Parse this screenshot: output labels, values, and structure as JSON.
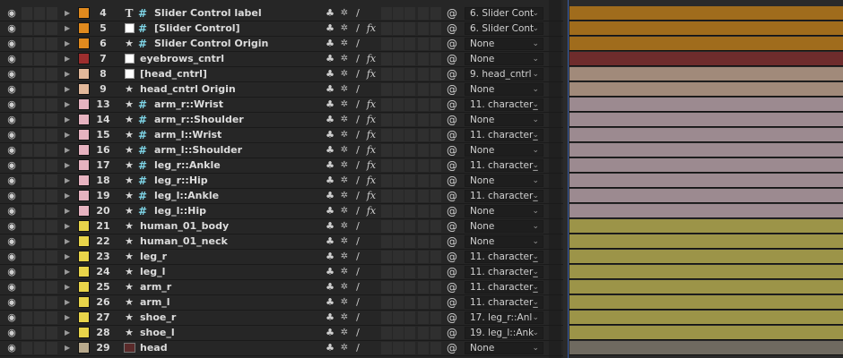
{
  "layers": [
    {
      "num": "4",
      "type": "text",
      "hash": true,
      "name": "Slider Control label",
      "label_color": "#e08a1e",
      "parent": "6. Slider Cont",
      "fx": false,
      "bar_color": "#a06c1c"
    },
    {
      "num": "5",
      "type": "solid",
      "hash": true,
      "name": "[Slider Control]",
      "label_color": "#e08a1e",
      "parent": "6. Slider Cont",
      "fx": true,
      "bar_color": "#a06c1c"
    },
    {
      "num": "6",
      "type": "star",
      "hash": true,
      "name": "Slider Control Origin",
      "label_color": "#e08a1e",
      "parent": "None",
      "fx": false,
      "bar_color": "#a06c1c"
    },
    {
      "num": "7",
      "type": "solid",
      "hash": false,
      "name": "eyebrows_cntrl",
      "label_color": "#9c2e2e",
      "parent": "None",
      "fx": true,
      "bar_color": "#6e2c2c"
    },
    {
      "num": "8",
      "type": "solid",
      "hash": false,
      "name": "[head_cntrl]",
      "label_color": "#e2b89a",
      "parent": "9. head_cntrl",
      "fx": true,
      "bar_color": "#a18a7a"
    },
    {
      "num": "9",
      "type": "star",
      "hash": false,
      "name": "head_cntrl Origin",
      "label_color": "#e2b89a",
      "parent": "None",
      "fx": false,
      "bar_color": "#a18a7a"
    },
    {
      "num": "13",
      "type": "star",
      "hash": true,
      "name": "arm_r::Wrist",
      "label_color": "#e6b3c0",
      "parent": "11. character_",
      "fx": true,
      "bar_color": "#9c8a90"
    },
    {
      "num": "14",
      "type": "star",
      "hash": true,
      "name": "arm_r::Shoulder",
      "label_color": "#e6b3c0",
      "parent": "None",
      "fx": true,
      "bar_color": "#9c8a90"
    },
    {
      "num": "15",
      "type": "star",
      "hash": true,
      "name": "arm_l::Wrist",
      "label_color": "#e6b3c0",
      "parent": "11. character_",
      "fx": true,
      "bar_color": "#9c8a90"
    },
    {
      "num": "16",
      "type": "star",
      "hash": true,
      "name": "arm_l::Shoulder",
      "label_color": "#e6b3c0",
      "parent": "None",
      "fx": true,
      "bar_color": "#9c8a90"
    },
    {
      "num": "17",
      "type": "star",
      "hash": true,
      "name": "leg_r::Ankle",
      "label_color": "#e6b3c0",
      "parent": "11. character_",
      "fx": true,
      "bar_color": "#9c8a90"
    },
    {
      "num": "18",
      "type": "star",
      "hash": true,
      "name": "leg_r::Hip",
      "label_color": "#e6b3c0",
      "parent": "None",
      "fx": true,
      "bar_color": "#9c8a90"
    },
    {
      "num": "19",
      "type": "star",
      "hash": true,
      "name": "leg_l::Ankle",
      "label_color": "#e6b3c0",
      "parent": "11. character_",
      "fx": true,
      "bar_color": "#9c8a90"
    },
    {
      "num": "20",
      "type": "star",
      "hash": true,
      "name": "leg_l::Hip",
      "label_color": "#e6b3c0",
      "parent": "None",
      "fx": true,
      "bar_color": "#9c8a90"
    },
    {
      "num": "21",
      "type": "star",
      "hash": false,
      "name": "human_01_body",
      "label_color": "#e8d44a",
      "parent": "None",
      "fx": false,
      "bar_color": "#9c9448"
    },
    {
      "num": "22",
      "type": "star",
      "hash": false,
      "name": "human_01_neck",
      "label_color": "#e8d44a",
      "parent": "None",
      "fx": false,
      "bar_color": "#9c9448"
    },
    {
      "num": "23",
      "type": "star",
      "hash": false,
      "name": "leg_r",
      "label_color": "#e8d44a",
      "parent": "11. character_",
      "fx": false,
      "bar_color": "#9c9448"
    },
    {
      "num": "24",
      "type": "star",
      "hash": false,
      "name": "leg_l",
      "label_color": "#e8d44a",
      "parent": "11. character_",
      "fx": false,
      "bar_color": "#9c9448"
    },
    {
      "num": "25",
      "type": "star",
      "hash": false,
      "name": "arm_r",
      "label_color": "#e8d44a",
      "parent": "11. character_",
      "fx": false,
      "bar_color": "#9c9448"
    },
    {
      "num": "26",
      "type": "star",
      "hash": false,
      "name": "arm_l",
      "label_color": "#e8d44a",
      "parent": "11. character_",
      "fx": false,
      "bar_color": "#9c9448"
    },
    {
      "num": "27",
      "type": "star",
      "hash": false,
      "name": "shoe_r",
      "label_color": "#e8d44a",
      "parent": "17. leg_r::Anl",
      "fx": false,
      "bar_color": "#9c9448"
    },
    {
      "num": "28",
      "type": "star",
      "hash": false,
      "name": "shoe_l",
      "label_color": "#e8d44a",
      "parent": "19. leg_l::Ank",
      "fx": false,
      "bar_color": "#9c9448"
    },
    {
      "num": "29",
      "type": "image",
      "hash": false,
      "name": "head",
      "label_color": "#b8a98c",
      "parent": "None",
      "fx": false,
      "bar_color": "#6f6a60"
    }
  ],
  "icons": {
    "eye": "◉",
    "twirl": "▶",
    "star": "★",
    "text": "T",
    "hash": "#",
    "shy": "♣",
    "quality": "✲",
    "slash": "/",
    "fx": "fx",
    "spiral": "@",
    "dropdown": "⌄"
  }
}
